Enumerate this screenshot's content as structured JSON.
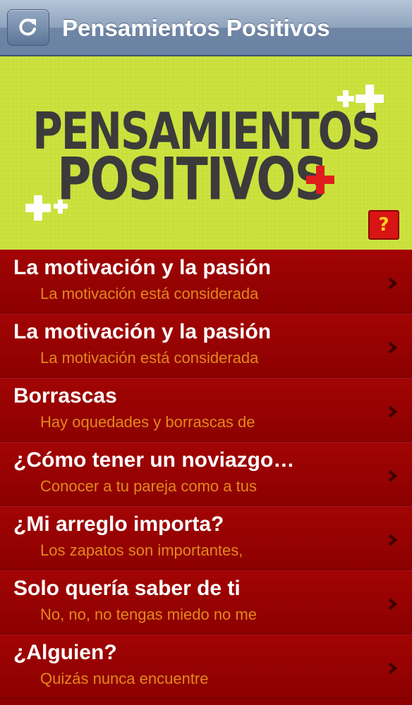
{
  "navbar": {
    "title": "Pensamientos Positivos",
    "refresh_icon": "refresh-icon"
  },
  "banner": {
    "line1": "PENSAMIENTOS",
    "line2": "POSITIVOS",
    "help_label": "?",
    "colors": {
      "background": "#c9e03a",
      "text": "#3b3b3b",
      "accent": "#e01d1d"
    }
  },
  "list": [
    {
      "title": "La motivación y la pasión",
      "subtitle": "La motivación está considerada"
    },
    {
      "title": "La motivación y la pasión",
      "subtitle": "La motivación está considerada"
    },
    {
      "title": "Borrascas",
      "subtitle": "Hay oquedades y borrascas de"
    },
    {
      "title": "¿Cómo tener un noviazgo…",
      "subtitle": "Conocer a tu pareja como a tus"
    },
    {
      "title": "¿Mi arreglo importa?",
      "subtitle": "Los zapatos son importantes,"
    },
    {
      "title": "Solo quería saber de ti",
      "subtitle": "No, no, no tengas miedo no me"
    },
    {
      "title": "¿Alguien?",
      "subtitle": "Quizás nunca encuentre"
    }
  ]
}
